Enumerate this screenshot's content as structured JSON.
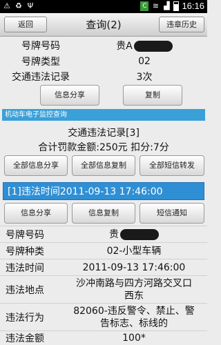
{
  "status_bar": {
    "time": "16:16",
    "left_icons": [
      "warning-icon",
      "recycle-icon",
      "usb-icon"
    ],
    "right_icons": [
      "sim-icon",
      "wifi-icon",
      "signal-icon",
      "battery-icon"
    ]
  },
  "header": {
    "back": "返回",
    "title": "查询(2)",
    "history": "违章历史"
  },
  "summary": {
    "plate_label": "号牌号码",
    "plate_value": "贵A",
    "type_label": "号牌类型",
    "type_value": "02",
    "record_label": "交通违法记录",
    "record_value": "3次",
    "share": "信息分享",
    "copy": "复制"
  },
  "section_title": "机动车电子监控查询",
  "records": {
    "title": "交通违法记录[3]",
    "totals": "合计罚款金额:250元 扣分:7分",
    "share_all": "全部信息分享",
    "copy_all": "全部信息复制",
    "sms_all": "全部短信转发"
  },
  "violation": {
    "banner": "[1]违法时间2011-09-13 17:46:00",
    "share": "信息分享",
    "copy": "信息复制",
    "sms": "短信通知",
    "fields": [
      {
        "label": "号牌号码",
        "value": "贵"
      },
      {
        "label": "号牌种类",
        "value": "02-小型车辆"
      },
      {
        "label": "违法时间",
        "value": "2011-09-13 17:46:00"
      },
      {
        "label": "违法地点",
        "value_line1": "沙冲南路与四方河路交叉口",
        "value_line2": "西东"
      },
      {
        "label": "违法行为",
        "value_line1": "82060-违反警令、禁止、警",
        "value_line2": "告标志、标线的"
      },
      {
        "label": "违法金额",
        "value": "100*"
      }
    ]
  }
}
